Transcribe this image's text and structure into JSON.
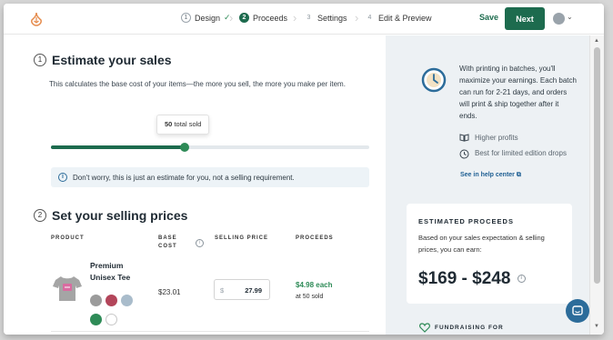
{
  "header": {
    "steps": [
      {
        "number": "1",
        "label": "Design",
        "state": "completed"
      },
      {
        "number": "2",
        "label": "Proceeds",
        "state": "active"
      },
      {
        "number": "3",
        "label": "Settings",
        "state": "upcoming"
      },
      {
        "number": "4",
        "label": "Edit & Preview",
        "state": "upcoming"
      }
    ],
    "save_label": "Save",
    "next_label": "Next"
  },
  "estimate": {
    "number": "1",
    "title": "Estimate your sales",
    "description": "This calculates the base cost of your items—the more you sell, the more you make per item.",
    "tooltip_count": "50",
    "tooltip_suffix": "total sold",
    "slider_fraction": 0.42,
    "notice": "Don't worry, this is just an estimate for you, not a selling requirement."
  },
  "pricing": {
    "number": "2",
    "title": "Set your selling prices",
    "columns": [
      "PRODUCT",
      "BASE COST",
      "SELLING PRICE",
      "PROCEEDS"
    ],
    "product": {
      "name": "Premium Unisex Tee",
      "base_cost": "$23.01",
      "currency": "$",
      "price": "27.99",
      "proceeds": "$4.98 each",
      "proceeds_sub": "at 50 sold",
      "swatches": [
        "#9b9b9b",
        "#b3455a",
        "#a9bccb",
        "#2e8b57",
        "#ffffff"
      ]
    }
  },
  "sidebar": {
    "info": "With printing in batches, you'll maximize your earnings. Each batch can run for 2-21 days, and orders will print & ship together after it ends.",
    "perks": [
      "Higher profits",
      "Best for limited edition drops"
    ],
    "help_link": "See in help center",
    "card": {
      "title": "ESTIMATED PROCEEDS",
      "desc": "Based on your sales expectation & selling prices, you can earn:",
      "range": "$169 - $248"
    },
    "fundraising": "FUNDRAISING FOR"
  },
  "colors": {
    "brand": "#1d6b4e",
    "accent_green": "#2e8b57",
    "link_blue": "#1e5f93",
    "sidebar_bg": "#edf1f4"
  }
}
